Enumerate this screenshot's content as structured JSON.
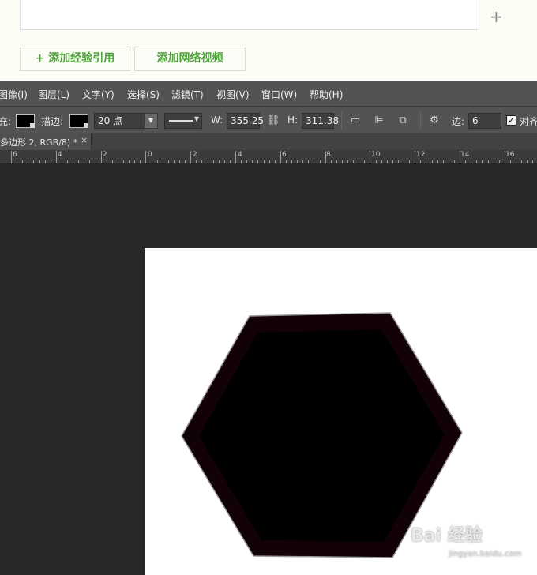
{
  "web": {
    "add_icon": "plus-icon",
    "buttons": {
      "add_experience_ref": "+ 添加经验引用",
      "add_web_video": "添加网络视频"
    }
  },
  "photoshop": {
    "menu": [
      "图像(I)",
      "图层(L)",
      "文字(Y)",
      "选择(S)",
      "滤镜(T)",
      "视图(V)",
      "窗口(W)",
      "帮助(H)"
    ],
    "options": {
      "fill_label": "充:",
      "stroke_label": "描边:",
      "stroke_width": "20 点",
      "w_label": "W:",
      "w_value": "355.25",
      "h_label": "H:",
      "h_value": "311.38",
      "sides_label": "边:",
      "sides_value": "6",
      "align_edges_label": "对齐",
      "fill_color": "#000000",
      "stroke_color": "#000000"
    },
    "document_tab": {
      "title": "多边形 2, RGB/8) *",
      "close": "×"
    },
    "ruler": [
      "6",
      "4",
      "2",
      "0",
      "2",
      "4",
      "6",
      "8",
      "10",
      "12",
      "14",
      "16"
    ]
  },
  "watermark": {
    "text": "Bai 经验",
    "url": "jingyan.baidu.com"
  }
}
